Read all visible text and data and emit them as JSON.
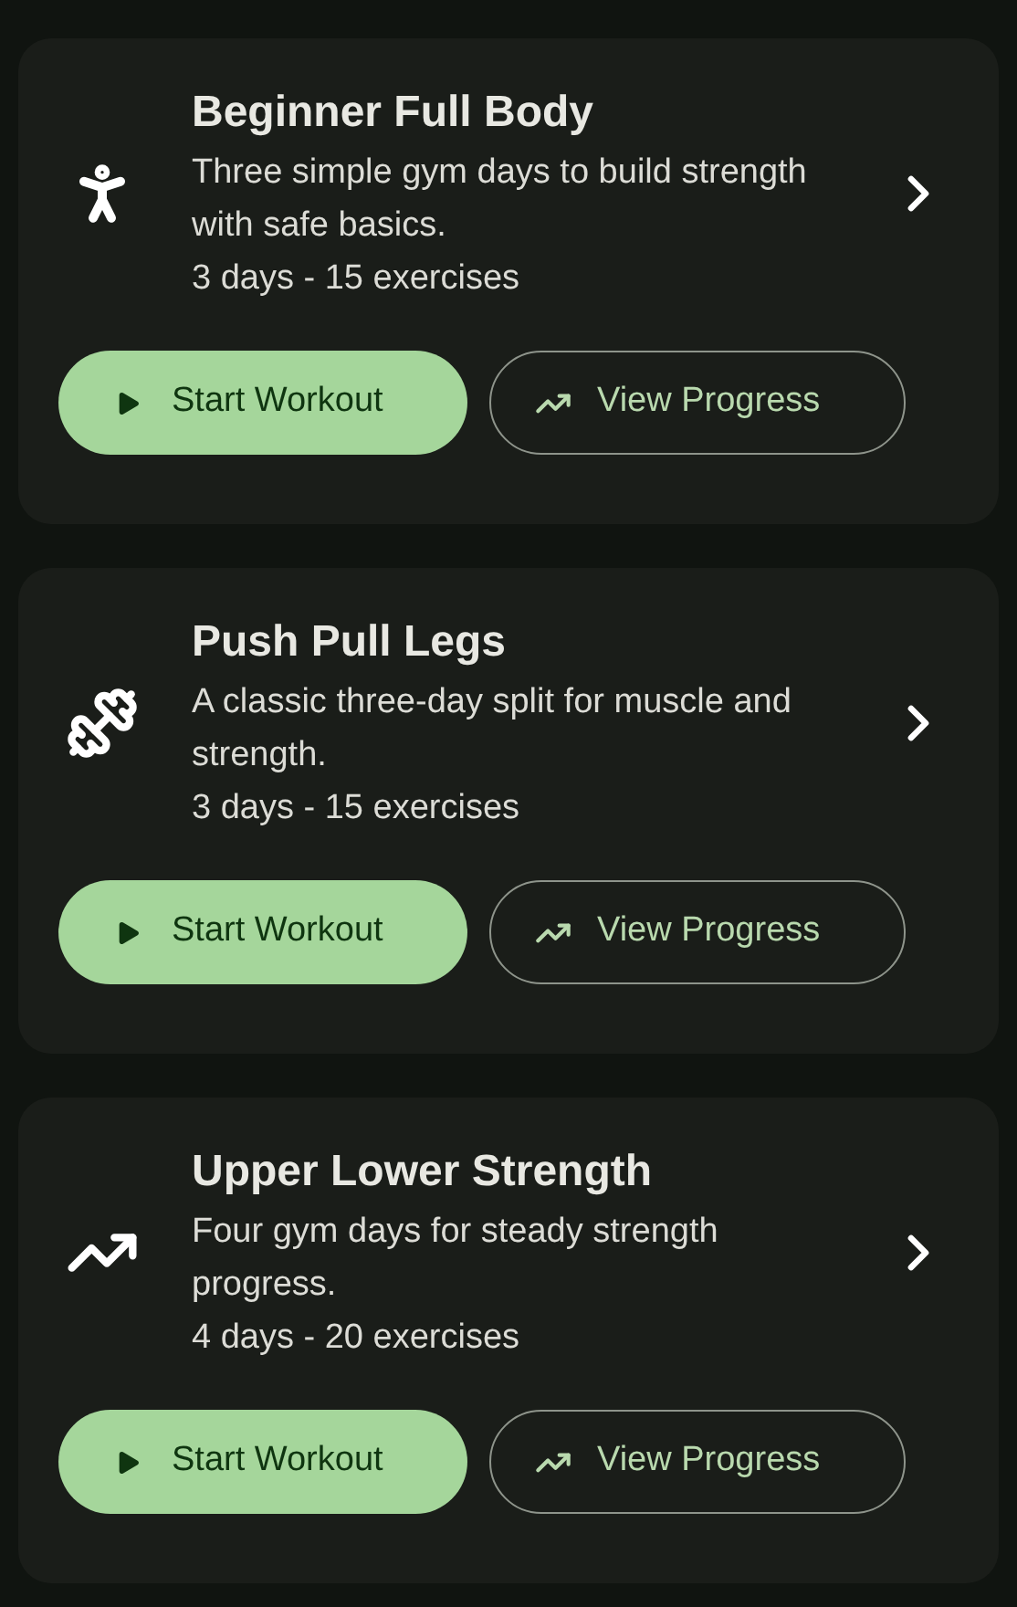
{
  "workouts": [
    {
      "kind": "person",
      "title": "Beginner Full Body",
      "description": "Three simple gym days to build strength with safe basics.",
      "meta": "3 days - 15 exercises",
      "primary_button": "Start Workout",
      "secondary_button": "View Progress"
    },
    {
      "kind": "dumbbell",
      "title": "Push Pull Legs",
      "description": "A classic three-day split for muscle and strength.",
      "meta": "3 days - 15 exercises",
      "primary_button": "Start Workout",
      "secondary_button": "View Progress"
    },
    {
      "kind": "trend",
      "title": "Upper Lower Strength",
      "description": "Four gym days for steady strength progress.",
      "meta": "4 days - 20 exercises",
      "primary_button": "Start Workout",
      "secondary_button": "View Progress"
    }
  ]
}
